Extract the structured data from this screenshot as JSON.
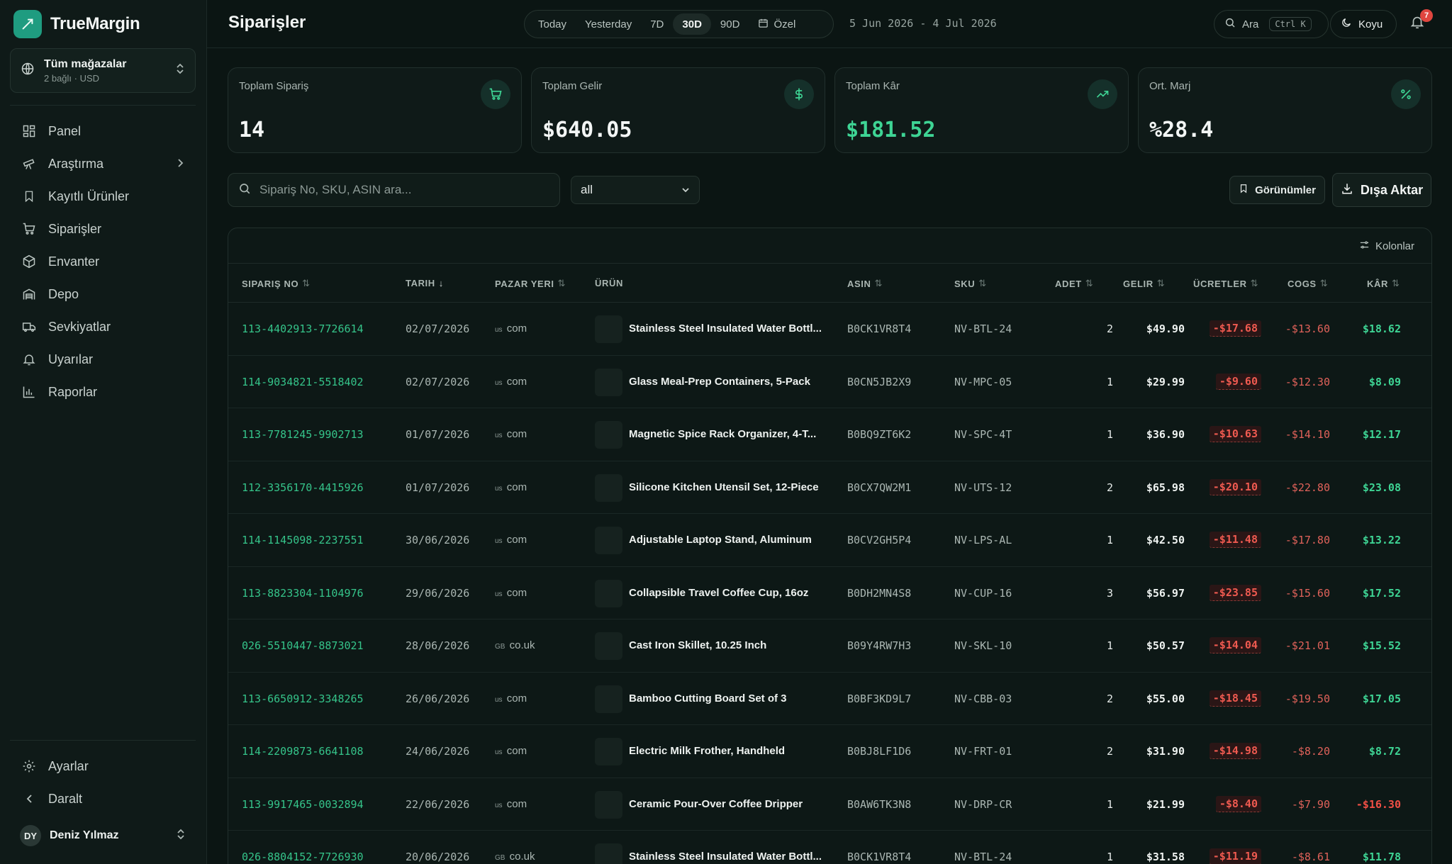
{
  "brand": {
    "name": "TrueMargin"
  },
  "store": {
    "title": "Tüm mağazalar",
    "subtitle": "2 bağlı · USD"
  },
  "nav": {
    "items": [
      {
        "label": "Panel",
        "icon": "grid-icon"
      },
      {
        "label": "Araştırma",
        "icon": "telescope-icon",
        "chevron": true
      },
      {
        "label": "Kayıtlı Ürünler",
        "icon": "bookmark-icon"
      },
      {
        "label": "Siparişler",
        "icon": "cart-icon"
      },
      {
        "label": "Envanter",
        "icon": "box-icon"
      },
      {
        "label": "Depo",
        "icon": "warehouse-icon"
      },
      {
        "label": "Sevkiyatlar",
        "icon": "truck-icon"
      },
      {
        "label": "Uyarılar",
        "icon": "bell-icon"
      },
      {
        "label": "Raporlar",
        "icon": "bar-chart-icon"
      }
    ],
    "bottom": [
      {
        "label": "Ayarlar",
        "icon": "gear-icon"
      },
      {
        "label": "Daralt",
        "icon": "chevron-left-icon"
      }
    ]
  },
  "user": {
    "initials": "DY",
    "name": "Deniz Yılmaz"
  },
  "header": {
    "title": "Siparişler",
    "ranges": [
      "Today",
      "Yesterday",
      "7D",
      "30D",
      "90D"
    ],
    "active_range": "30D",
    "custom_label": "Özel",
    "date_range": "5 Jun 2026 - 4 Jul 2026",
    "search_label": "Ara",
    "search_shortcut": "Ctrl K",
    "theme_label": "Koyu",
    "notification_count": "7"
  },
  "kpis": [
    {
      "label": "Toplam Sipariş",
      "value": "14",
      "icon": "cart-icon",
      "green": false
    },
    {
      "label": "Toplam Gelir",
      "value": "$640.05",
      "icon": "dollar-icon",
      "green": false
    },
    {
      "label": "Toplam Kâr",
      "value": "$181.52",
      "icon": "trending-up-icon",
      "green": true
    },
    {
      "label": "Ort. Marj",
      "value": "%28.4",
      "icon": "percent-icon",
      "green": false
    }
  ],
  "filters": {
    "search_placeholder": "Sipariş No, SKU, ASIN ara...",
    "marketplace_value": "all",
    "views_label": "Görünümler",
    "export_label": "Dışa Aktar"
  },
  "table": {
    "columns_label": "Kolonlar",
    "headers": {
      "order": "SIPARIŞ NO",
      "date": "TARIH",
      "market": "PAZAR YERI",
      "product": "ÜRÜN",
      "asin": "ASIN",
      "sku": "SKU",
      "qty": "ADET",
      "revenue": "GELIR",
      "fees": "ÜCRETLER",
      "cogs": "COGS",
      "profit": "KÂR"
    },
    "rows": [
      {
        "order": "113-4402913-7726614",
        "date": "02/07/2026",
        "flag": "us",
        "market": "com",
        "product": "Stainless Steel Insulated Water Bottl...",
        "asin": "B0CK1VR8T4",
        "sku": "NV-BTL-24",
        "qty": "2",
        "revenue": "$49.90",
        "fees": "-$17.68",
        "cogs": "-$13.60",
        "profit": "$18.62",
        "neg": false
      },
      {
        "order": "114-9034821-5518402",
        "date": "02/07/2026",
        "flag": "us",
        "market": "com",
        "product": "Glass Meal-Prep Containers, 5-Pack",
        "asin": "B0CN5JB2X9",
        "sku": "NV-MPC-05",
        "qty": "1",
        "revenue": "$29.99",
        "fees": "-$9.60",
        "cogs": "-$12.30",
        "profit": "$8.09",
        "neg": false
      },
      {
        "order": "113-7781245-9902713",
        "date": "01/07/2026",
        "flag": "us",
        "market": "com",
        "product": "Magnetic Spice Rack Organizer, 4-T...",
        "asin": "B0BQ9ZT6K2",
        "sku": "NV-SPC-4T",
        "qty": "1",
        "revenue": "$36.90",
        "fees": "-$10.63",
        "cogs": "-$14.10",
        "profit": "$12.17",
        "neg": false
      },
      {
        "order": "112-3356170-4415926",
        "date": "01/07/2026",
        "flag": "us",
        "market": "com",
        "product": "Silicone Kitchen Utensil Set, 12-Piece",
        "asin": "B0CX7QW2M1",
        "sku": "NV-UTS-12",
        "qty": "2",
        "revenue": "$65.98",
        "fees": "-$20.10",
        "cogs": "-$22.80",
        "profit": "$23.08",
        "neg": false
      },
      {
        "order": "114-1145098-2237551",
        "date": "30/06/2026",
        "flag": "us",
        "market": "com",
        "product": "Adjustable Laptop Stand, Aluminum",
        "asin": "B0CV2GH5P4",
        "sku": "NV-LPS-AL",
        "qty": "1",
        "revenue": "$42.50",
        "fees": "-$11.48",
        "cogs": "-$17.80",
        "profit": "$13.22",
        "neg": false
      },
      {
        "order": "113-8823304-1104976",
        "date": "29/06/2026",
        "flag": "us",
        "market": "com",
        "product": "Collapsible Travel Coffee Cup, 16oz",
        "asin": "B0DH2MN4S8",
        "sku": "NV-CUP-16",
        "qty": "3",
        "revenue": "$56.97",
        "fees": "-$23.85",
        "cogs": "-$15.60",
        "profit": "$17.52",
        "neg": false
      },
      {
        "order": "026-5510447-8873021",
        "date": "28/06/2026",
        "flag": "GB",
        "market": "co.uk",
        "product": "Cast Iron Skillet, 10.25 Inch",
        "asin": "B09Y4RW7H3",
        "sku": "NV-SKL-10",
        "qty": "1",
        "revenue": "$50.57",
        "fees": "-$14.04",
        "cogs": "-$21.01",
        "profit": "$15.52",
        "neg": false
      },
      {
        "order": "113-6650912-3348265",
        "date": "26/06/2026",
        "flag": "us",
        "market": "com",
        "product": "Bamboo Cutting Board Set of 3",
        "asin": "B0BF3KD9L7",
        "sku": "NV-CBB-03",
        "qty": "2",
        "revenue": "$55.00",
        "fees": "-$18.45",
        "cogs": "-$19.50",
        "profit": "$17.05",
        "neg": false
      },
      {
        "order": "114-2209873-6641108",
        "date": "24/06/2026",
        "flag": "us",
        "market": "com",
        "product": "Electric Milk Frother, Handheld",
        "asin": "B0BJ8LF1D6",
        "sku": "NV-FRT-01",
        "qty": "2",
        "revenue": "$31.90",
        "fees": "-$14.98",
        "cogs": "-$8.20",
        "profit": "$8.72",
        "neg": false
      },
      {
        "order": "113-9917465-0032894",
        "date": "22/06/2026",
        "flag": "us",
        "market": "com",
        "product": "Ceramic Pour-Over Coffee Dripper",
        "asin": "B0AW6TK3N8",
        "sku": "NV-DRP-CR",
        "qty": "1",
        "revenue": "$21.99",
        "fees": "-$8.40",
        "cogs": "-$7.90",
        "profit": "-$16.30",
        "neg": true
      },
      {
        "order": "026-8804152-7726930",
        "date": "20/06/2026",
        "flag": "GB",
        "market": "co.uk",
        "product": "Stainless Steel Insulated Water Bottl...",
        "asin": "B0CK1VR8T4",
        "sku": "NV-BTL-24",
        "qty": "1",
        "revenue": "$31.58",
        "fees": "-$11.19",
        "cogs": "-$8.61",
        "profit": "$11.78",
        "neg": false
      }
    ]
  },
  "colors": {
    "accent": "#1f9c80",
    "profit_green": "#3ed494",
    "order_link": "#35c48a",
    "negative_red": "#ef5a50"
  }
}
